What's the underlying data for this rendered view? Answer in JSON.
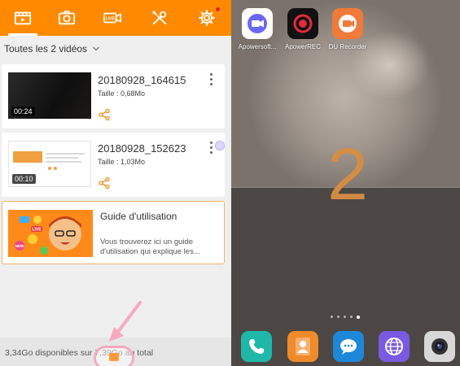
{
  "left_app": {
    "tabs": [
      {
        "icon": "video-list-icon",
        "active": true
      },
      {
        "icon": "camera-icon",
        "active": false
      },
      {
        "icon": "live-icon",
        "active": false,
        "icon_text": "LIVE"
      },
      {
        "icon": "tools-icon",
        "active": false
      },
      {
        "icon": "gear-icon",
        "active": false,
        "notification_dot": true
      }
    ],
    "filter_label": "Toutes les 2 vidéos",
    "videos": [
      {
        "title": "20180928_164615",
        "size": "Taille : 0,68Mo",
        "duration": "00:24"
      },
      {
        "title": "20180928_152623",
        "size": "Taille : 1,03Mo",
        "duration": "00:10"
      }
    ],
    "guide": {
      "title": "Guide d'utilisation",
      "description": "Vous trouverez ici un guide d'utilisation qui explique les...",
      "image_badge": "LIVE",
      "image_badge2": "NEW"
    },
    "storage_text": "3,34Go disponibles sur 7,39Go au total",
    "colors": {
      "accent": "#ff8a00",
      "annotation": "#f8a8c0",
      "card_border": "#f3b26a"
    }
  },
  "home_screen": {
    "apps": [
      {
        "label": "Apowersoft...",
        "icon": "apowersoft-icon",
        "color": "#ffffff"
      },
      {
        "label": "ApowerREC",
        "icon": "apowerrec-icon",
        "color": "#111111"
      },
      {
        "label": "DU Recorder",
        "icon": "du-recorder-icon",
        "color": "#f07a3a"
      }
    ],
    "countdown_number": "2",
    "page_dots": 5,
    "active_page": 4,
    "dock": [
      {
        "icon": "phone-icon",
        "color": "#1fb8a8"
      },
      {
        "icon": "contacts-icon",
        "color": "#f08a2a"
      },
      {
        "icon": "messages-icon",
        "color": "#1e88d8"
      },
      {
        "icon": "browser-icon",
        "color": "#7a5ae0"
      },
      {
        "icon": "camera-icon",
        "color": "#d8d8d8"
      }
    ],
    "colors": {
      "countdown": "#d88e42"
    }
  }
}
